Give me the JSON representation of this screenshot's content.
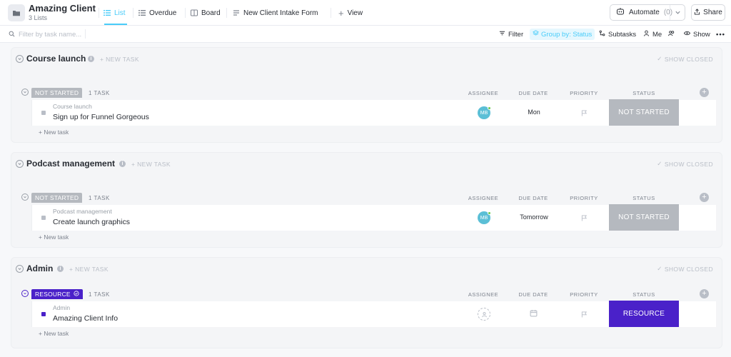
{
  "header": {
    "title": "Amazing Client",
    "subtitle": "3 Lists",
    "tabs": [
      {
        "label": "List",
        "icon": "list-icon",
        "active": true
      },
      {
        "label": "Overdue",
        "icon": "list-icon"
      },
      {
        "label": "Board",
        "icon": "board-icon"
      },
      {
        "label": "New Client Intake Form",
        "icon": "form-icon"
      }
    ],
    "add_view": "View",
    "automate": {
      "label": "Automate",
      "count": "(0)"
    },
    "share": "Share"
  },
  "filterbar": {
    "search_placeholder": "Filter by task name...",
    "filter": "Filter",
    "group_by": "Group by: Status",
    "subtasks": "Subtasks",
    "me": "Me"
  },
  "columns": {
    "assignee": "ASSIGNEE",
    "due": "DUE DATE",
    "priority": "PRIORITY",
    "status": "STATUS"
  },
  "sections": [
    {
      "title": "Course launch",
      "new_task": "+ NEW TASK",
      "show_closed": "SHOW CLOSED",
      "group": {
        "status": "NOT STARTED",
        "color": "#b5b9bf",
        "count": "1 TASK"
      },
      "task": {
        "crumb": "Course launch",
        "name": "Sign up for Funnel Gorgeous",
        "assignee": "MB",
        "due": "Mon",
        "status": "NOT STARTED",
        "status_color": "#b5b9bf"
      },
      "new_task_row": "+ New task"
    },
    {
      "title": "Podcast management",
      "new_task": "+ NEW TASK",
      "show_closed": "SHOW CLOSED",
      "group": {
        "status": "NOT STARTED",
        "color": "#b5b9bf",
        "count": "1 TASK"
      },
      "task": {
        "crumb": "Podcast management",
        "name": "Create launch graphics",
        "assignee": "MB",
        "due": "Tomorrow",
        "status": "NOT STARTED",
        "status_color": "#b5b9bf"
      },
      "new_task_row": "+ New task"
    },
    {
      "title": "Admin",
      "new_task": "+ NEW TASK",
      "show_closed": "SHOW CLOSED",
      "group": {
        "status": "RESOURCE",
        "color": "#4a21c9",
        "count": "1 TASK"
      },
      "task": {
        "crumb": "Admin",
        "name": "Amazing Client Info",
        "assignee": "",
        "due": "",
        "status": "RESOURCE",
        "status_color": "#4a21c9"
      },
      "new_task_row": "+ New task"
    }
  ]
}
